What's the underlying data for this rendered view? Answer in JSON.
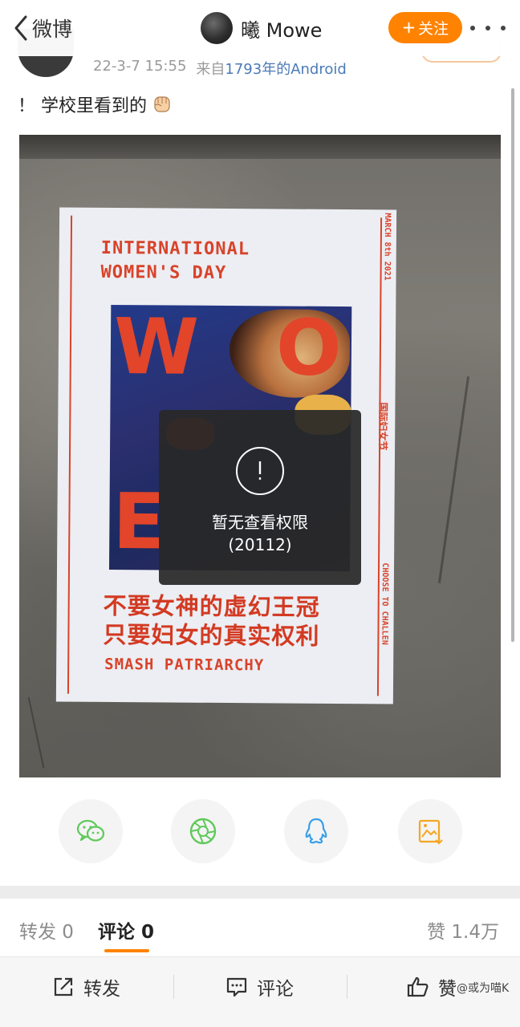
{
  "nav": {
    "back_label": "微博",
    "username": "曦 Mowe",
    "follow_label": "关注"
  },
  "post": {
    "timestamp": "22-3-7 15:55",
    "source_prefix": "来自",
    "source": "1793年的Android",
    "text": "！ 学校里看到的",
    "emoji": "fist-emoji"
  },
  "poster": {
    "title_line1": "INTERNATIONAL",
    "title_line2": "WOMEN'S DAY",
    "art_letters": [
      "W",
      "O",
      "E"
    ],
    "cn_line1": "不要女神的虚幻王冠",
    "cn_line2": "只要妇女的真实权利",
    "slogan": "SMASH PATRIARCHY",
    "side_date": "MARCH 8th 2021",
    "side_cn": "国际妇女节",
    "side_choose": "CHOOSE TO CHALLEN"
  },
  "permission": {
    "icon": "exclamation-icon",
    "message": "暂无查看权限",
    "code": "(20112)"
  },
  "share": {
    "items": [
      "wechat-icon",
      "moments-icon",
      "qq-icon",
      "save-image-icon"
    ]
  },
  "tabs": {
    "repost": "转发 0",
    "comment": "评论 0",
    "like": "赞 1.4万"
  },
  "actions": {
    "repost": "转发",
    "comment": "评论",
    "like": "赞"
  },
  "watermark": "@或为喵K",
  "colors": {
    "accent": "#ff8200",
    "link": "#4a7bb7",
    "poster_red": "#d9432a",
    "wechat_green": "#5ec95a",
    "qq_blue": "#3aa0e8",
    "save_orange": "#f5a623"
  }
}
